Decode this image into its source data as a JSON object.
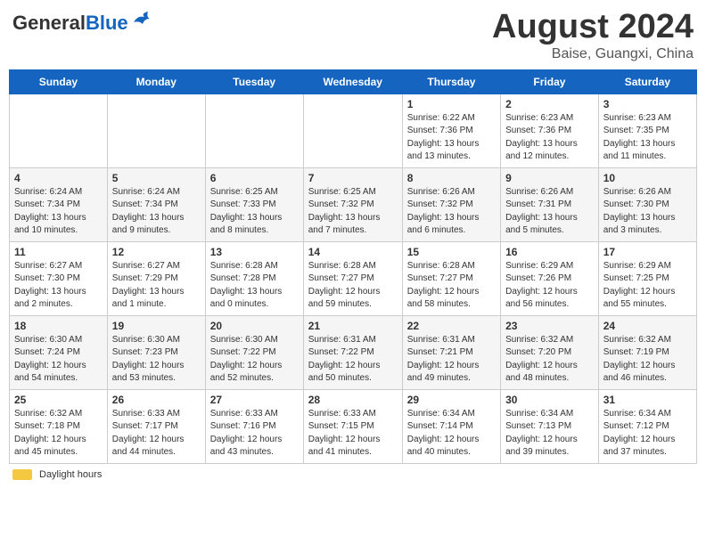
{
  "header": {
    "logo_general": "General",
    "logo_blue": "Blue",
    "month_year": "August 2024",
    "location": "Baise, Guangxi, China"
  },
  "days_of_week": [
    "Sunday",
    "Monday",
    "Tuesday",
    "Wednesday",
    "Thursday",
    "Friday",
    "Saturday"
  ],
  "weeks": [
    [
      {
        "day": "",
        "info": ""
      },
      {
        "day": "",
        "info": ""
      },
      {
        "day": "",
        "info": ""
      },
      {
        "day": "",
        "info": ""
      },
      {
        "day": "1",
        "info": "Sunrise: 6:22 AM\nSunset: 7:36 PM\nDaylight: 13 hours and 13 minutes."
      },
      {
        "day": "2",
        "info": "Sunrise: 6:23 AM\nSunset: 7:36 PM\nDaylight: 13 hours and 12 minutes."
      },
      {
        "day": "3",
        "info": "Sunrise: 6:23 AM\nSunset: 7:35 PM\nDaylight: 13 hours and 11 minutes."
      }
    ],
    [
      {
        "day": "4",
        "info": "Sunrise: 6:24 AM\nSunset: 7:34 PM\nDaylight: 13 hours and 10 minutes."
      },
      {
        "day": "5",
        "info": "Sunrise: 6:24 AM\nSunset: 7:34 PM\nDaylight: 13 hours and 9 minutes."
      },
      {
        "day": "6",
        "info": "Sunrise: 6:25 AM\nSunset: 7:33 PM\nDaylight: 13 hours and 8 minutes."
      },
      {
        "day": "7",
        "info": "Sunrise: 6:25 AM\nSunset: 7:32 PM\nDaylight: 13 hours and 7 minutes."
      },
      {
        "day": "8",
        "info": "Sunrise: 6:26 AM\nSunset: 7:32 PM\nDaylight: 13 hours and 6 minutes."
      },
      {
        "day": "9",
        "info": "Sunrise: 6:26 AM\nSunset: 7:31 PM\nDaylight: 13 hours and 5 minutes."
      },
      {
        "day": "10",
        "info": "Sunrise: 6:26 AM\nSunset: 7:30 PM\nDaylight: 13 hours and 3 minutes."
      }
    ],
    [
      {
        "day": "11",
        "info": "Sunrise: 6:27 AM\nSunset: 7:30 PM\nDaylight: 13 hours and 2 minutes."
      },
      {
        "day": "12",
        "info": "Sunrise: 6:27 AM\nSunset: 7:29 PM\nDaylight: 13 hours and 1 minute."
      },
      {
        "day": "13",
        "info": "Sunrise: 6:28 AM\nSunset: 7:28 PM\nDaylight: 13 hours and 0 minutes."
      },
      {
        "day": "14",
        "info": "Sunrise: 6:28 AM\nSunset: 7:27 PM\nDaylight: 12 hours and 59 minutes."
      },
      {
        "day": "15",
        "info": "Sunrise: 6:28 AM\nSunset: 7:27 PM\nDaylight: 12 hours and 58 minutes."
      },
      {
        "day": "16",
        "info": "Sunrise: 6:29 AM\nSunset: 7:26 PM\nDaylight: 12 hours and 56 minutes."
      },
      {
        "day": "17",
        "info": "Sunrise: 6:29 AM\nSunset: 7:25 PM\nDaylight: 12 hours and 55 minutes."
      }
    ],
    [
      {
        "day": "18",
        "info": "Sunrise: 6:30 AM\nSunset: 7:24 PM\nDaylight: 12 hours and 54 minutes."
      },
      {
        "day": "19",
        "info": "Sunrise: 6:30 AM\nSunset: 7:23 PM\nDaylight: 12 hours and 53 minutes."
      },
      {
        "day": "20",
        "info": "Sunrise: 6:30 AM\nSunset: 7:22 PM\nDaylight: 12 hours and 52 minutes."
      },
      {
        "day": "21",
        "info": "Sunrise: 6:31 AM\nSunset: 7:22 PM\nDaylight: 12 hours and 50 minutes."
      },
      {
        "day": "22",
        "info": "Sunrise: 6:31 AM\nSunset: 7:21 PM\nDaylight: 12 hours and 49 minutes."
      },
      {
        "day": "23",
        "info": "Sunrise: 6:32 AM\nSunset: 7:20 PM\nDaylight: 12 hours and 48 minutes."
      },
      {
        "day": "24",
        "info": "Sunrise: 6:32 AM\nSunset: 7:19 PM\nDaylight: 12 hours and 46 minutes."
      }
    ],
    [
      {
        "day": "25",
        "info": "Sunrise: 6:32 AM\nSunset: 7:18 PM\nDaylight: 12 hours and 45 minutes."
      },
      {
        "day": "26",
        "info": "Sunrise: 6:33 AM\nSunset: 7:17 PM\nDaylight: 12 hours and 44 minutes."
      },
      {
        "day": "27",
        "info": "Sunrise: 6:33 AM\nSunset: 7:16 PM\nDaylight: 12 hours and 43 minutes."
      },
      {
        "day": "28",
        "info": "Sunrise: 6:33 AM\nSunset: 7:15 PM\nDaylight: 12 hours and 41 minutes."
      },
      {
        "day": "29",
        "info": "Sunrise: 6:34 AM\nSunset: 7:14 PM\nDaylight: 12 hours and 40 minutes."
      },
      {
        "day": "30",
        "info": "Sunrise: 6:34 AM\nSunset: 7:13 PM\nDaylight: 12 hours and 39 minutes."
      },
      {
        "day": "31",
        "info": "Sunrise: 6:34 AM\nSunset: 7:12 PM\nDaylight: 12 hours and 37 minutes."
      }
    ]
  ],
  "legend": {
    "label": "Daylight hours"
  }
}
